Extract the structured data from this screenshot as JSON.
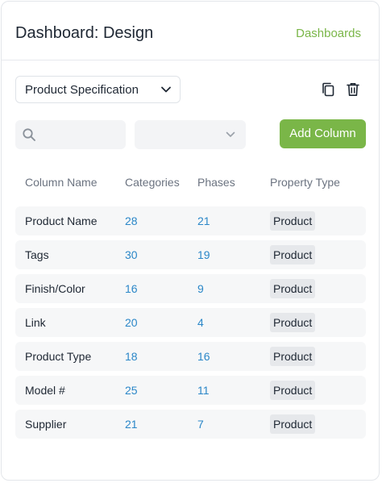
{
  "header": {
    "title": "Dashboard: Design",
    "link_label": "Dashboards"
  },
  "toolbar": {
    "spec_select_value": "Product Specification",
    "copy_icon": "copy-icon",
    "delete_icon": "trash-icon"
  },
  "filters": {
    "search_icon": "search-icon",
    "search_placeholder": "",
    "filter_select_value": "",
    "add_column_label": "Add Column"
  },
  "table": {
    "headers": [
      "Column Name",
      "Categories",
      "Phases",
      "Property Type"
    ],
    "rows": [
      {
        "name": "Product Name",
        "categories": "28",
        "phases": "21",
        "property_type": "Product"
      },
      {
        "name": "Tags",
        "categories": "30",
        "phases": "19",
        "property_type": "Product"
      },
      {
        "name": "Finish/Color",
        "categories": "16",
        "phases": "9",
        "property_type": "Product"
      },
      {
        "name": "Link",
        "categories": "20",
        "phases": "4",
        "property_type": "Product"
      },
      {
        "name": "Product Type",
        "categories": "18",
        "phases": "16",
        "property_type": "Product"
      },
      {
        "name": "Model #",
        "categories": "25",
        "phases": "11",
        "property_type": "Product"
      },
      {
        "name": "Supplier",
        "categories": "21",
        "phases": "7",
        "property_type": "Product"
      }
    ]
  },
  "colors": {
    "accent": "#7ab648",
    "link_number": "#2b87c8",
    "text": "#1e2733",
    "muted": "#6b7380"
  }
}
